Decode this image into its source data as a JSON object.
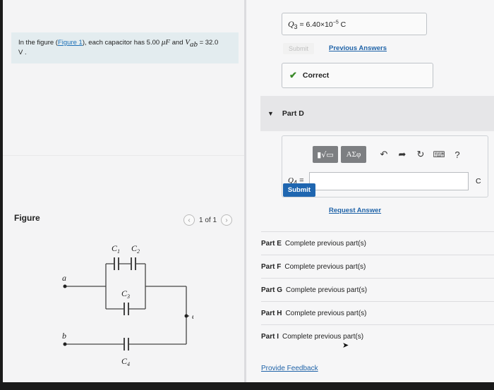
{
  "problem": {
    "text_pre": "In the figure (",
    "figure_link": "Figure 1",
    "text_mid": "), each capacitor has 5.00 ",
    "mu_f": "μF",
    "text_and": " and ",
    "vab_label": "V",
    "vab_sub": "ab",
    "text_end": " = 32.0",
    "units": "V ."
  },
  "figure": {
    "heading": "Figure",
    "pager_text": "1 of 1",
    "prev_icon": "chevron-left-icon",
    "next_icon": "chevron-right-icon",
    "labels": {
      "c1": "C",
      "c1_sub": "1",
      "c2": "C",
      "c2_sub": "2",
      "c3": "C",
      "c3_sub": "3",
      "c4": "C",
      "c4_sub": "4",
      "a": "a",
      "b": "b",
      "d": "d"
    }
  },
  "part_c": {
    "answer_label": "Q",
    "answer_sub": "3",
    "answer_value": " = 6.40×10",
    "answer_exp": "−5",
    "answer_unit": " C",
    "submit_label": "Submit",
    "previous_answers": "Previous Answers",
    "correct_text": "Correct"
  },
  "part_d": {
    "title": "Part D",
    "toolbar": {
      "template_label": "▮√▭",
      "greek_label": "ΑΣφ",
      "undo_icon": "undo-icon",
      "redo_icon": "redo-icon",
      "reset_icon": "reset-icon",
      "keyboard_icon": "keyboard-icon",
      "help_label": "?"
    },
    "q_label": "Q",
    "q_sub": "4",
    "q_equals": " =",
    "input_value": "",
    "unit": "C",
    "submit_label": "Submit",
    "request_answer": "Request Answer"
  },
  "parts": [
    {
      "name": "Part E",
      "status": "Complete previous part(s)"
    },
    {
      "name": "Part F",
      "status": "Complete previous part(s)"
    },
    {
      "name": "Part G",
      "status": "Complete previous part(s)"
    },
    {
      "name": "Part H",
      "status": "Complete previous part(s)"
    },
    {
      "name": "Part I",
      "status": "Complete previous part(s)"
    }
  ],
  "footer": {
    "feedback_link": "Provide Feedback"
  },
  "colors": {
    "link": "#1f63a8",
    "submit": "#1f66b0",
    "correct_check": "#3b8a2a",
    "problem_bg": "#e3ecef"
  }
}
